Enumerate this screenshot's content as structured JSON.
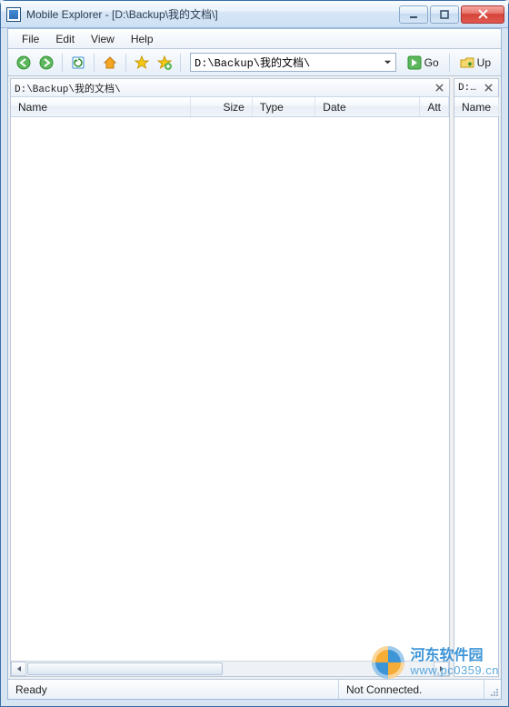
{
  "window": {
    "title": "Mobile Explorer - [D:\\Backup\\我的文档\\]"
  },
  "menu": {
    "file": "File",
    "edit": "Edit",
    "view": "View",
    "help": "Help"
  },
  "toolbar": {
    "address_value": "D:\\Backup\\我的文档\\",
    "go_label": "Go",
    "up_label": "Up"
  },
  "left_pane": {
    "tab_path": "D:\\Backup\\我的文档\\",
    "columns": {
      "name": "Name",
      "size": "Size",
      "type": "Type",
      "date": "Date",
      "attr": "Att"
    },
    "rows": []
  },
  "right_pane": {
    "tab_path": "D:...",
    "columns": {
      "name": "Name"
    },
    "rows": []
  },
  "status": {
    "ready": "Ready",
    "connection": "Not Connected."
  },
  "watermark": {
    "cn": "河东软件园",
    "url": "www.pc0359.cn"
  }
}
